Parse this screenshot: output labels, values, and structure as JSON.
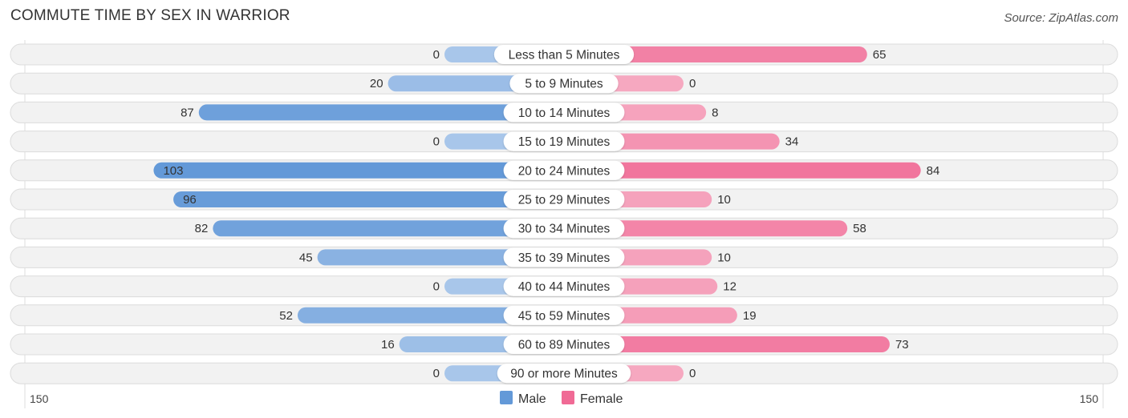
{
  "header": {
    "title": "COMMUTE TIME BY SEX IN WARRIOR",
    "source": "Source: ZipAtlas.com"
  },
  "colors": {
    "male_strong": "#6399d8",
    "male_light": "#a8c6ea",
    "female_strong": "#f06a95",
    "female_light": "#f6a8c0",
    "row_bg": "#f2f2f2"
  },
  "chart_data": {
    "type": "bar",
    "orientation": "horizontal-diverging",
    "title": "COMMUTE TIME BY SEX IN WARRIOR",
    "categories": [
      "Less than 5 Minutes",
      "5 to 9 Minutes",
      "10 to 14 Minutes",
      "15 to 19 Minutes",
      "20 to 24 Minutes",
      "25 to 29 Minutes",
      "30 to 34 Minutes",
      "35 to 39 Minutes",
      "40 to 44 Minutes",
      "45 to 59 Minutes",
      "60 to 89 Minutes",
      "90 or more Minutes"
    ],
    "series": [
      {
        "name": "Male",
        "values": [
          0,
          20,
          87,
          0,
          103,
          96,
          82,
          45,
          0,
          52,
          16,
          0
        ]
      },
      {
        "name": "Female",
        "values": [
          65,
          0,
          8,
          34,
          84,
          10,
          58,
          10,
          12,
          19,
          73,
          0
        ]
      }
    ],
    "axis": {
      "left_label": "150",
      "right_label": "150",
      "range": [
        0,
        150
      ]
    },
    "legend": {
      "position": "bottom-center",
      "items": [
        "Male",
        "Female"
      ]
    }
  }
}
